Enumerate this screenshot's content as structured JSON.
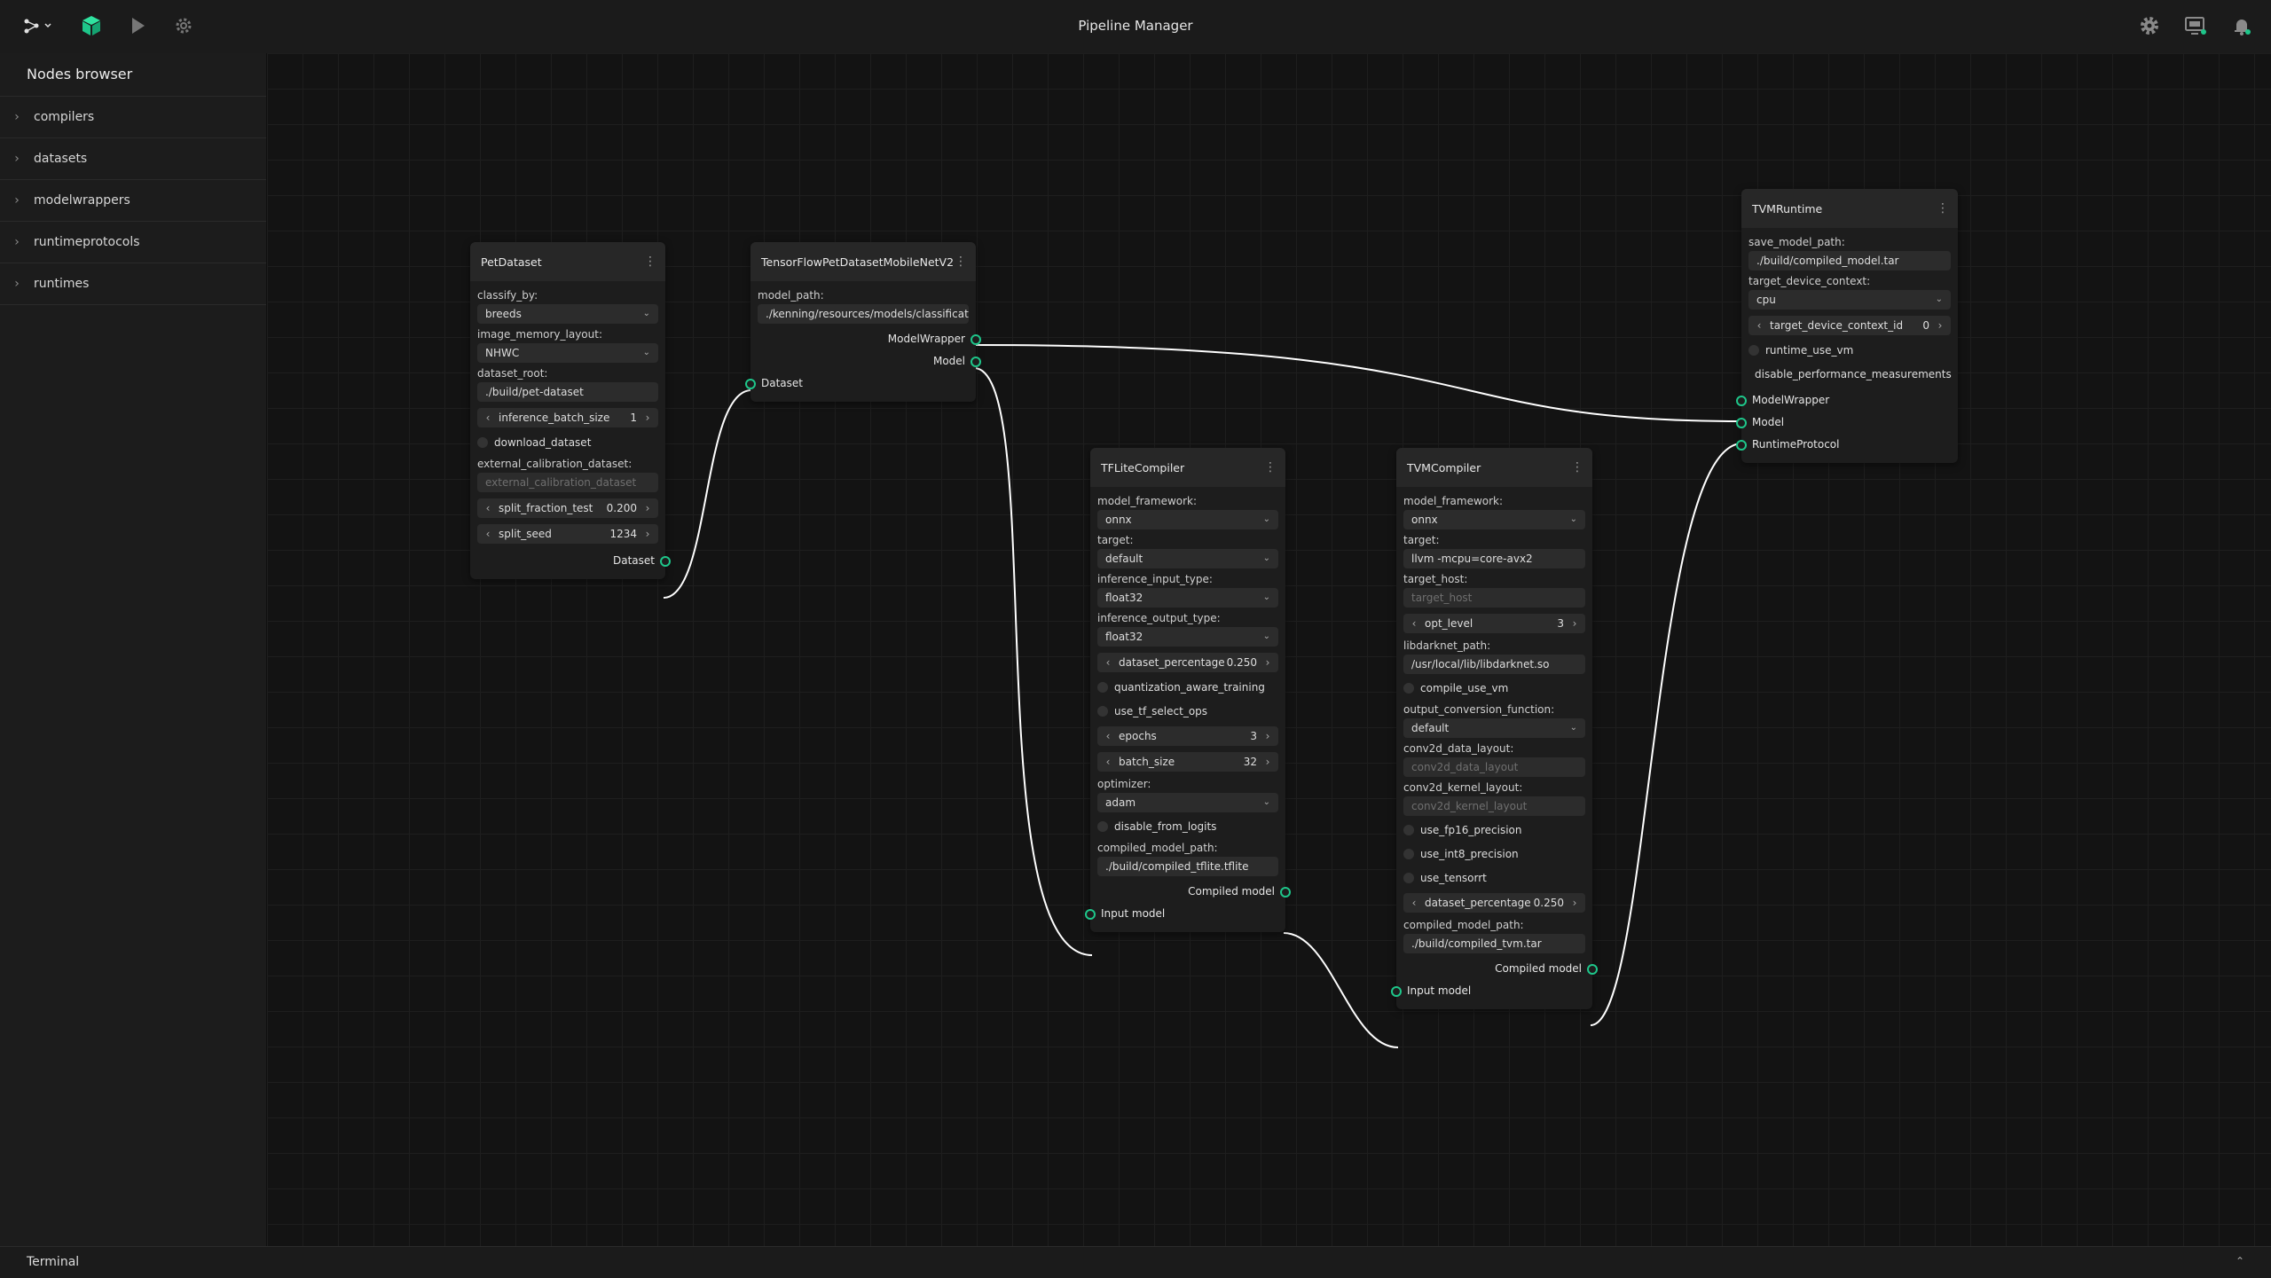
{
  "app": {
    "title": "Pipeline Manager",
    "accent_color": "#1ec68a",
    "icons": {
      "graph_menu": "graph-icon",
      "cube": "cube-icon",
      "run": "play-icon",
      "validate": "gear-icon",
      "settings": "settings-icon",
      "backend": "monitor-icon",
      "notifications": "bell-icon"
    }
  },
  "sidebar": {
    "title": "Nodes browser",
    "items": [
      "compilers",
      "datasets",
      "modelwrappers",
      "runtimeprotocols",
      "runtimes"
    ]
  },
  "terminal": {
    "label": "Terminal"
  },
  "nodes": {
    "petdataset": {
      "title": "PetDataset",
      "classify_by_label": "classify_by:",
      "classify_by_value": "breeds",
      "image_memory_layout_label": "image_memory_layout:",
      "image_memory_layout_value": "NHWC",
      "dataset_root_label": "dataset_root:",
      "dataset_root_value": "./build/pet-dataset",
      "inference_batch_size_label": "inference_batch_size",
      "inference_batch_size_value": "1",
      "download_dataset_label": "download_dataset",
      "external_calibration_dataset_label": "external_calibration_dataset:",
      "external_calibration_dataset_placeholder": "external_calibration_dataset",
      "split_fraction_test_label": "split_fraction_test",
      "split_fraction_test_value": "0.200",
      "split_seed_label": "split_seed",
      "split_seed_value": "1234",
      "out_dataset": "Dataset"
    },
    "tfmodel": {
      "title": "TensorFlowPetDatasetMobileNetV2",
      "model_path_label": "model_path:",
      "model_path_value": "./kenning/resources/models/classificatic",
      "out_modelwrapper": "ModelWrapper",
      "out_model": "Model",
      "in_dataset": "Dataset"
    },
    "tflite": {
      "title": "TFLiteCompiler",
      "model_framework_label": "model_framework:",
      "model_framework_value": "onnx",
      "target_label": "target:",
      "target_value": "default",
      "inference_input_type_label": "inference_input_type:",
      "inference_input_type_value": "float32",
      "inference_output_type_label": "inference_output_type:",
      "inference_output_type_value": "float32",
      "dataset_percentage_label": "dataset_percentage",
      "dataset_percentage_value": "0.250",
      "quantization_aware_training_label": "quantization_aware_training",
      "use_tf_select_ops_label": "use_tf_select_ops",
      "epochs_label": "epochs",
      "epochs_value": "3",
      "batch_size_label": "batch_size",
      "batch_size_value": "32",
      "optimizer_label": "optimizer:",
      "optimizer_value": "adam",
      "disable_from_logits_label": "disable_from_logits",
      "compiled_model_path_label": "compiled_model_path:",
      "compiled_model_path_value": "./build/compiled_tflite.tflite",
      "out_compiled_model": "Compiled model",
      "in_input_model": "Input model"
    },
    "tvmcompiler": {
      "title": "TVMCompiler",
      "model_framework_label": "model_framework:",
      "model_framework_value": "onnx",
      "target_label": "target:",
      "target_value": "llvm -mcpu=core-avx2",
      "target_host_label": "target_host:",
      "target_host_placeholder": "target_host",
      "opt_level_label": "opt_level",
      "opt_level_value": "3",
      "libdarknet_path_label": "libdarknet_path:",
      "libdarknet_path_value": "/usr/local/lib/libdarknet.so",
      "compile_use_vm_label": "compile_use_vm",
      "output_conversion_function_label": "output_conversion_function:",
      "output_conversion_function_value": "default",
      "conv2d_data_layout_label": "conv2d_data_layout:",
      "conv2d_data_layout_placeholder": "conv2d_data_layout",
      "conv2d_kernel_layout_label": "conv2d_kernel_layout:",
      "conv2d_kernel_layout_placeholder": "conv2d_kernel_layout",
      "use_fp16_precision_label": "use_fp16_precision",
      "use_int8_precision_label": "use_int8_precision",
      "use_tensorrt_label": "use_tensorrt",
      "dataset_percentage_label": "dataset_percentage",
      "dataset_percentage_value": "0.250",
      "compiled_model_path_label": "compiled_model_path:",
      "compiled_model_path_value": "./build/compiled_tvm.tar",
      "out_compiled_model": "Compiled model",
      "in_input_model": "Input model"
    },
    "tvmruntime": {
      "title": "TVMRuntime",
      "save_model_path_label": "save_model_path:",
      "save_model_path_value": "./build/compiled_model.tar",
      "target_device_context_label": "target_device_context:",
      "target_device_context_value": "cpu",
      "target_device_context_id_label": "target_device_context_id",
      "target_device_context_id_value": "0",
      "runtime_use_vm_label": "runtime_use_vm",
      "disable_performance_measurements_label": "disable_performance_measurements",
      "in_modelwrapper": "ModelWrapper",
      "in_model": "Model",
      "in_runtimeprotocol": "RuntimeProtocol"
    }
  }
}
